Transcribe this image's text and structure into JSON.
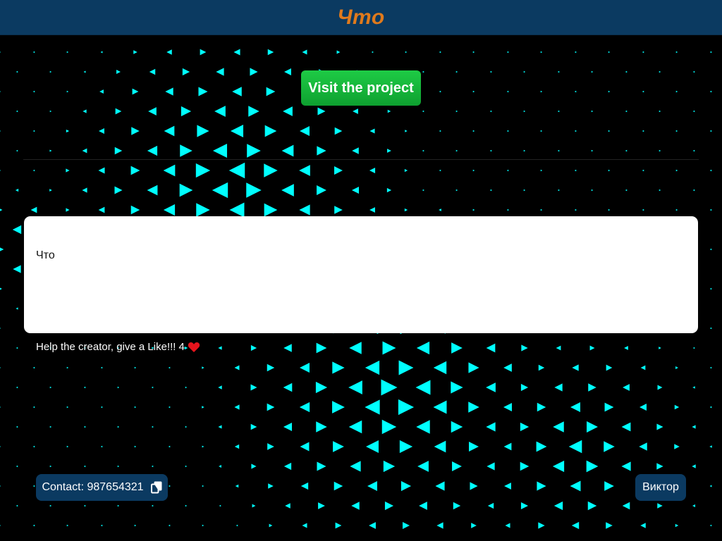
{
  "header": {
    "title": "Что"
  },
  "hero": {
    "visit_label": "Visit the project"
  },
  "content": {
    "text": "Что"
  },
  "like": {
    "text": "Help the creator, give a Like!!!",
    "count": "4"
  },
  "footer": {
    "contact_text": "Contact: 987654321",
    "author_name": "Виктор"
  },
  "icons": {
    "heart": "heart-icon",
    "copy": "copy-icon"
  },
  "colors": {
    "header_bg": "#0b3a61",
    "title": "#e07a1c",
    "visit_button": "#16b83b",
    "pattern": "#00ffff",
    "heart": "#e8141c"
  }
}
